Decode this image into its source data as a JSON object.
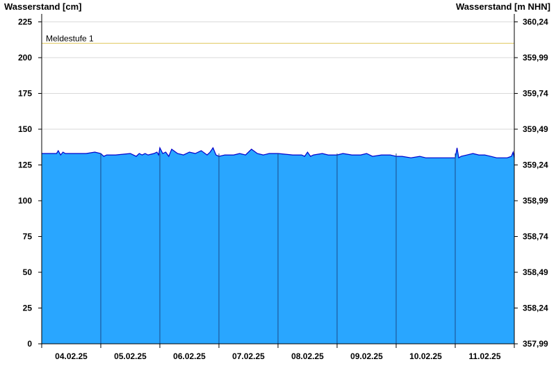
{
  "chart_data": {
    "type": "area",
    "title": "",
    "ylabel_left": "Wasserstand [cm]",
    "ylabel_right": "Wasserstand [m NHN]",
    "ylim_left": [
      0,
      230
    ],
    "yticks_left": [
      "0",
      "25",
      "50",
      "75",
      "100",
      "125",
      "150",
      "175",
      "200",
      "225"
    ],
    "yticks_right": [
      "357,99",
      "358,24",
      "358,49",
      "358,74",
      "358,99",
      "359,24",
      "359,49",
      "359,74",
      "359,99",
      "360,24"
    ],
    "xlim_days": [
      0,
      8
    ],
    "x_tick_labels": [
      "04.02.25",
      "05.02.25",
      "06.02.25",
      "07.02.25",
      "08.02.25",
      "09.02.25",
      "10.02.25",
      "11.02.25"
    ],
    "grid": true,
    "threshold": {
      "label": "Meldestufe 1",
      "value": 210,
      "color": "#e6d27a"
    },
    "fill_color": "#29a6ff",
    "line_color": "#0000cc",
    "day_marker_color": "#1a4a8a",
    "series": [
      {
        "x": [
          0,
          0.25,
          0.28,
          0.32,
          0.36,
          0.4,
          0.5,
          0.75,
          0.9,
          1.0,
          1.05,
          1.1,
          1.25,
          1.5,
          1.6,
          1.65,
          1.7,
          1.75,
          1.8,
          1.9,
          1.95,
          1.98,
          2.0,
          2.05,
          2.1,
          2.15,
          2.2,
          2.3,
          2.4,
          2.5,
          2.6,
          2.7,
          2.8,
          2.85,
          2.9,
          2.95,
          3.0,
          3.1,
          3.25,
          3.35,
          3.45,
          3.55,
          3.65,
          3.75,
          3.85,
          4.0,
          4.25,
          4.4,
          4.45,
          4.5,
          4.55,
          4.6,
          4.75,
          4.85,
          5.0,
          5.1,
          5.25,
          5.4,
          5.5,
          5.6,
          5.75,
          5.9,
          6.0,
          6.1,
          6.25,
          6.4,
          6.5,
          6.75,
          6.95,
          7.0,
          7.03,
          7.06,
          7.1,
          7.2,
          7.3,
          7.4,
          7.5,
          7.6,
          7.7,
          7.8,
          7.88,
          7.95,
          7.98,
          8.0
        ],
        "values": [
          133,
          133,
          135,
          132,
          134,
          133,
          133,
          133,
          134,
          133,
          131,
          132,
          132,
          133,
          131,
          133,
          132,
          133,
          132,
          133,
          134,
          132,
          137,
          133,
          134,
          131,
          136,
          133,
          132,
          134,
          133,
          135,
          132,
          134,
          137,
          132,
          131,
          132,
          132,
          133,
          132,
          136,
          133,
          132,
          133,
          133,
          132,
          132,
          131,
          134,
          131,
          132,
          133,
          132,
          132,
          133,
          132,
          132,
          133,
          131,
          132,
          132,
          131,
          131,
          130,
          131,
          130,
          130,
          130,
          130,
          137,
          130,
          131,
          132,
          133,
          132,
          132,
          131,
          130,
          130,
          130,
          131,
          134,
          130
        ]
      }
    ]
  }
}
